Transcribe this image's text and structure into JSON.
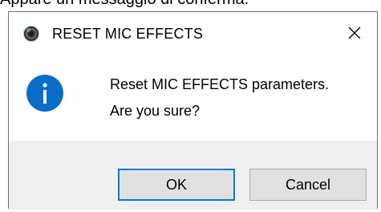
{
  "caption": "Appare un messaggio di conferma.",
  "dialog": {
    "title": "RESET MIC EFFECTS",
    "app_icon": "mic-effects-app-icon",
    "close_icon": "close-icon",
    "info_icon": "information-icon",
    "message_lines": [
      "Reset MIC EFFECTS parameters.",
      "Are you sure?"
    ],
    "buttons": {
      "ok_label": "OK",
      "cancel_label": "Cancel"
    },
    "colors": {
      "info_blue": "#0a6cc9",
      "focus_border": "#0078d7",
      "footer_bg": "#f0f0f0",
      "button_bg": "#e1e1e1"
    }
  }
}
